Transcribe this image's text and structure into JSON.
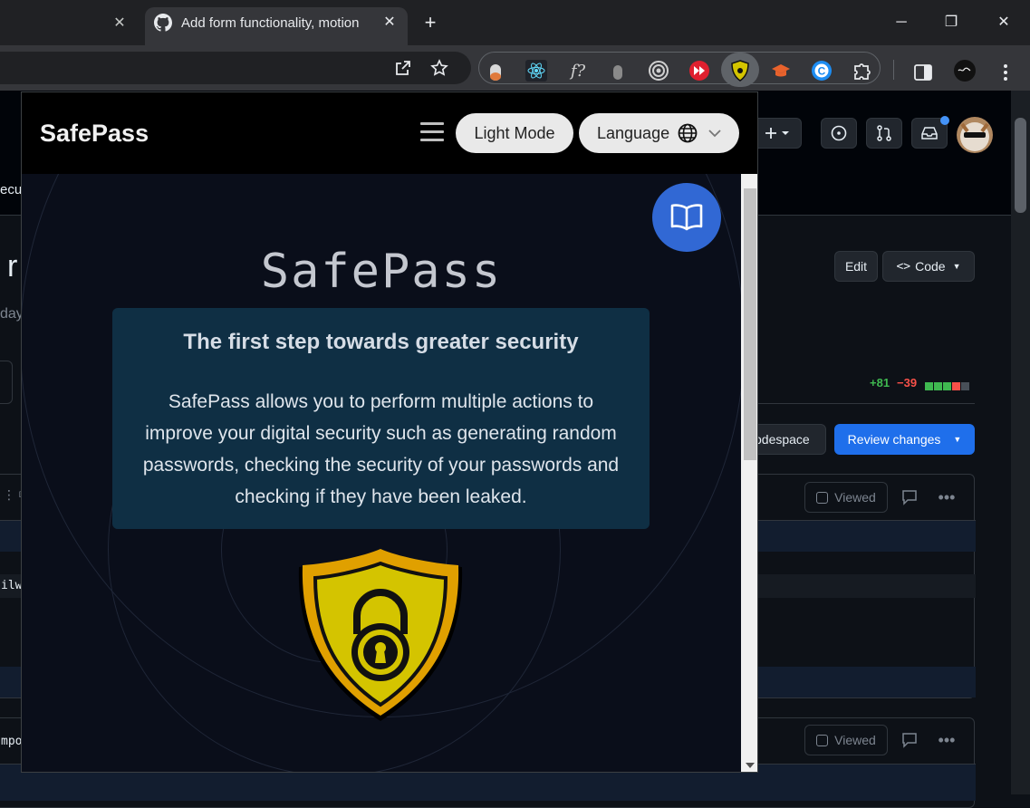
{
  "browser": {
    "active_tab_title": "Add form functionality, motion",
    "tab_close": "✕",
    "new_tab": "+",
    "window_controls": {
      "minimize": "─",
      "restore": "❐",
      "close": "✕"
    }
  },
  "toolbar": {
    "icons": [
      "open-in-new-icon",
      "bookmark-star-icon"
    ],
    "extensions": [
      "capsule-ext-icon",
      "react-devtools-icon",
      "fx-ext-icon",
      "bulb-ext-icon",
      "target-ext-icon",
      "forward-ext-icon",
      "safepass-ext-icon",
      "hat-ext-icon",
      "c-ext-icon",
      "puzzle-icon"
    ],
    "menu_icon": "kebab-menu-icon"
  },
  "github": {
    "fragment_security": "ecu",
    "fragment_title": "r",
    "fragment_day": "day",
    "edit_label": "Edit",
    "code_label": "Code",
    "additions": "+81",
    "deletions": "−39",
    "codespace_label": "odespace",
    "review_label": "Review changes",
    "viewed_label": "Viewed",
    "fragment_code1": "ilw",
    "fragment_code2": "mpo",
    "colors": {
      "add": "#3fb950",
      "del": "#f85149",
      "primary": "#1f6feb"
    }
  },
  "popup": {
    "brand": "SafePass",
    "light_mode_label": "Light Mode",
    "language_label": "Language",
    "hero_title": "SafePass",
    "card_title": "The first step towards greater security",
    "card_description": "SafePass allows you to perform multiple actions to improve your digital security such as generating random passwords, checking the security of your passwords and checking if they have been leaked.",
    "colors": {
      "accent": "#3168d4",
      "card": "#0f2f44",
      "shield": "#d4c400",
      "shield_border": "#e0a000"
    }
  }
}
